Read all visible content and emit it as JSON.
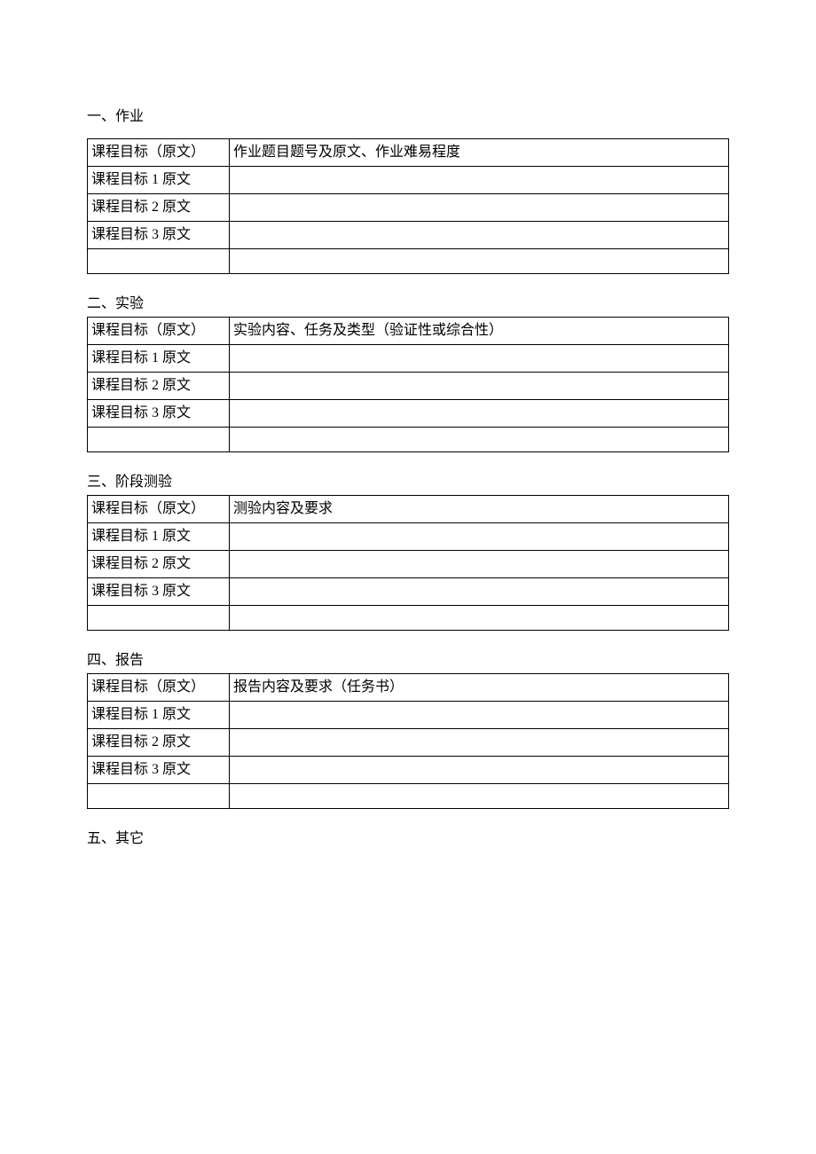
{
  "sections": [
    {
      "title": "一、作业",
      "header_col1": "课程目标（原文）",
      "header_col2": "作业题目题号及原文、作业难易程度",
      "rows": [
        {
          "col1": "课程目标 1 原文",
          "col2": ""
        },
        {
          "col1": "课程目标 2 原文",
          "col2": ""
        },
        {
          "col1": "课程目标 3 原文",
          "col2": ""
        },
        {
          "col1": "",
          "col2": ""
        }
      ],
      "spaced": true
    },
    {
      "title": "二、实验",
      "header_col1": "课程目标（原文）",
      "header_col2": "实验内容、任务及类型（验证性或综合性）",
      "rows": [
        {
          "col1": "课程目标 1 原文",
          "col2": ""
        },
        {
          "col1": "课程目标 2 原文",
          "col2": ""
        },
        {
          "col1": "课程目标 3 原文",
          "col2": ""
        },
        {
          "col1": "",
          "col2": ""
        }
      ],
      "spaced": false
    },
    {
      "title": "三、阶段测验",
      "header_col1": "课程目标（原文）",
      "header_col2": "测验内容及要求",
      "rows": [
        {
          "col1": "课程目标 1 原文",
          "col2": ""
        },
        {
          "col1": "课程目标 2 原文",
          "col2": ""
        },
        {
          "col1": "课程目标 3 原文",
          "col2": ""
        },
        {
          "col1": "",
          "col2": ""
        }
      ],
      "spaced": false
    },
    {
      "title": "四、报告",
      "header_col1": "课程目标（原文）",
      "header_col2": "报告内容及要求（任务书）",
      "rows": [
        {
          "col1": "课程目标 1 原文",
          "col2": ""
        },
        {
          "col1": "课程目标 2 原文",
          "col2": ""
        },
        {
          "col1": "课程目标 3 原文",
          "col2": ""
        },
        {
          "col1": "",
          "col2": ""
        }
      ],
      "spaced": false
    }
  ],
  "last_section_title": "五、其它"
}
